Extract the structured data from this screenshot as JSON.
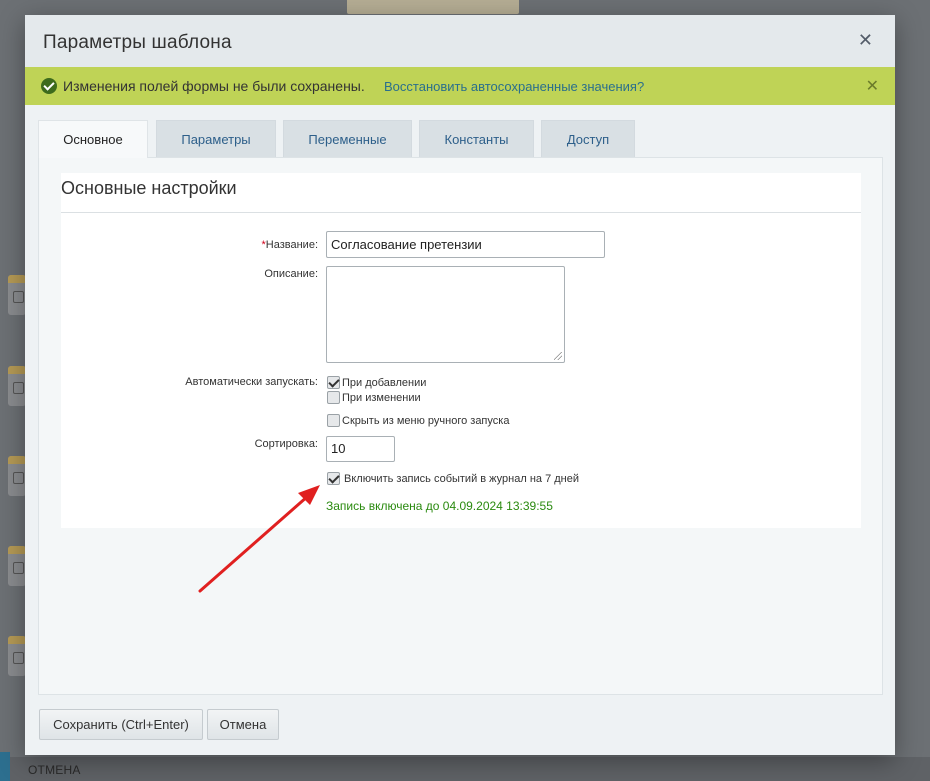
{
  "background": {
    "footer_label": "ОТМЕНА"
  },
  "dialog": {
    "title": "Параметры шаблона",
    "close_icon": "close-icon"
  },
  "notice": {
    "text": "Изменения полей формы не были сохранены.",
    "link": "Восстановить автосохраненные значения?",
    "color": "#bfd356"
  },
  "tabs": [
    {
      "label": "Основное",
      "active": true
    },
    {
      "label": "Параметры",
      "active": false
    },
    {
      "label": "Переменные",
      "active": false
    },
    {
      "label": "Константы",
      "active": false
    },
    {
      "label": "Доступ",
      "active": false
    }
  ],
  "section": {
    "title": "Основные настройки"
  },
  "form": {
    "name_required_mark": "*",
    "name_label": "Название:",
    "name_value": "Согласование претензии",
    "description_label": "Описание:",
    "description_value": "",
    "autostart_label": "Автоматически запускать:",
    "autostart_options": [
      {
        "label": "При добавлении",
        "checked": true
      },
      {
        "label": "При изменении",
        "checked": false
      }
    ],
    "hide_manual": {
      "label": "Скрыть из меню ручного запуска",
      "checked": false
    },
    "sort_label": "Сортировка:",
    "sort_value": "10",
    "log": {
      "label": "Включить запись событий в журнал на 7 дней",
      "checked": true
    },
    "log_status": "Запись включена до 04.09.2024 13:39:55"
  },
  "buttons": {
    "save": "Сохранить (Ctrl+Enter)",
    "cancel": "Отмена"
  },
  "annotation": {
    "arrow_color": "#e02020"
  }
}
